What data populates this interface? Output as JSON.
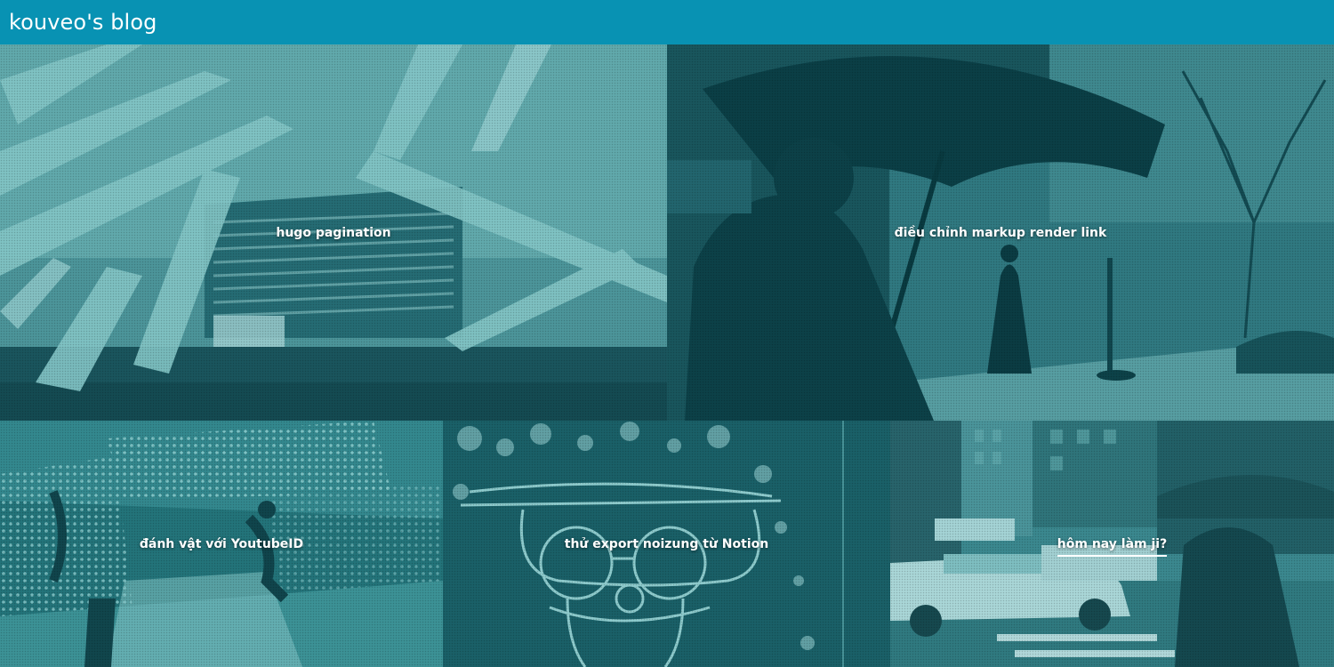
{
  "header": {
    "title": "kouveo's blog",
    "background": "#0892b3"
  },
  "posts": [
    {
      "title": "hugo pagination"
    },
    {
      "title": "điều chỉnh markup render link"
    },
    {
      "title": "đánh vật với YoutubeID"
    },
    {
      "title": "thử export noizung từ Notion"
    },
    {
      "title": "hôm nay làm ji?",
      "active": true
    }
  ],
  "colors": {
    "tint": "#2a8f98",
    "dark": "#0e3a40",
    "light": "#8fd3d6"
  }
}
